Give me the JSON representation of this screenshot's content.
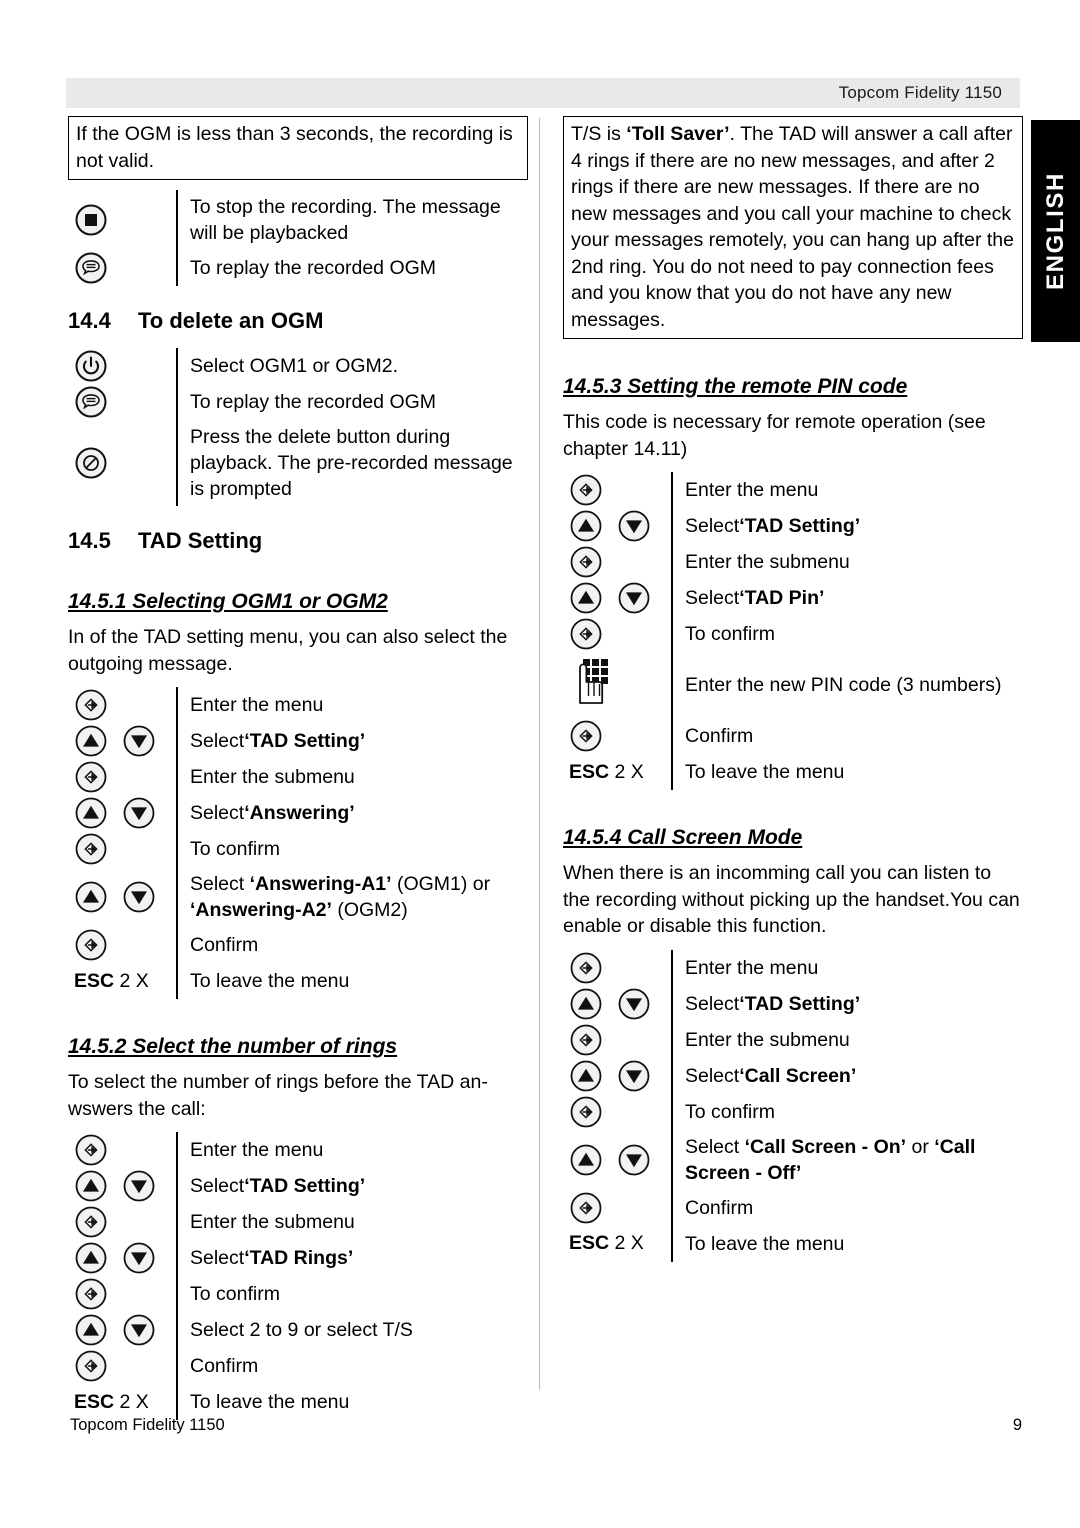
{
  "header": {
    "title": "Topcom Fidelity 1150"
  },
  "lang_tab": {
    "label": "ENGLISH"
  },
  "footer": {
    "doc_name": "Topcom Fidelity 1150",
    "page_number": "9"
  },
  "left_column": {
    "note_box": "If the OGM is less than 3 seconds, the recording is not valid.",
    "ogm_record_steps": [
      {
        "icon_a": "stop-icon",
        "icon_b": "",
        "text": "To stop the recording. The message will be playbacked"
      },
      {
        "icon_a": "replay-ogm-icon",
        "icon_b": "",
        "text": "To replay the recorded OGM"
      }
    ],
    "section_14_4": {
      "number": "14.4",
      "title": "To delete an OGM",
      "steps": [
        {
          "icon_a": "power-icon",
          "icon_b": "",
          "text": "Select OGM1 or OGM2."
        },
        {
          "icon_a": "replay-ogm-icon",
          "icon_b": "",
          "text": "To replay the recorded OGM"
        },
        {
          "icon_a": "delete-icon",
          "icon_b": "",
          "text": "Press the delete button during playback. The pre-recorded message is prompted"
        }
      ]
    },
    "section_14_5": {
      "number": "14.5",
      "title": "TAD Setting"
    },
    "section_14_5_1": {
      "title": "14.5.1 Selecting OGM1 or OGM2",
      "intro": "In of the TAD setting menu, you can also select the outgoing message.",
      "steps": [
        {
          "icon_a": "menu-enter-icon",
          "icon_b": "",
          "text": "Enter the menu"
        },
        {
          "icon_a": "up-arrow-icon",
          "icon_b": "down-arrow-icon",
          "text": "Select ",
          "bold": "‘TAD Setting’",
          "text_after": ""
        },
        {
          "icon_a": "menu-enter-icon",
          "icon_b": "",
          "text": "Enter the submenu"
        },
        {
          "icon_a": "up-arrow-icon",
          "icon_b": "down-arrow-icon",
          "text": "Select ",
          "bold": "‘Answering’",
          "text_after": ""
        },
        {
          "icon_a": "menu-enter-icon",
          "icon_b": "",
          "text": "To confirm"
        },
        {
          "icon_a": "up-arrow-icon",
          "icon_b": "down-arrow-icon",
          "text": "Select ",
          "bold": "‘Answering-A1’",
          "text_after": " (OGM1) or ",
          "bold2": "‘Answering-A2’",
          "text_after2": " (OGM2)"
        },
        {
          "icon_a": "menu-enter-icon",
          "icon_b": "",
          "text": "Confirm"
        },
        {
          "icon_a": "esc-label",
          "esc_bold": "ESC",
          "esc_rest": "2 X",
          "icon_b": "",
          "text": "To leave the menu"
        }
      ]
    },
    "section_14_5_2": {
      "title": "14.5.2 Select the number of rings",
      "intro": "To select the number of rings before the TAD an-wswers the call:",
      "steps": [
        {
          "icon_a": "menu-enter-icon",
          "icon_b": "",
          "text": "Enter the menu"
        },
        {
          "icon_a": "up-arrow-icon",
          "icon_b": "down-arrow-icon",
          "text": "Select ",
          "bold": "‘TAD Setting’"
        },
        {
          "icon_a": "menu-enter-icon",
          "icon_b": "",
          "text": "Enter the submenu"
        },
        {
          "icon_a": "up-arrow-icon",
          "icon_b": "down-arrow-icon",
          "text": "Select ",
          "bold": "‘TAD Rings’"
        },
        {
          "icon_a": "menu-enter-icon",
          "icon_b": "",
          "text": "To confirm"
        },
        {
          "icon_a": "up-arrow-icon",
          "icon_b": "down-arrow-icon",
          "text": "Select 2 to 9 or select T/S"
        },
        {
          "icon_a": "menu-enter-icon",
          "icon_b": "",
          "text": "Confirm"
        },
        {
          "icon_a": "esc-label",
          "esc_bold": "ESC",
          "esc_rest": "2 X",
          "icon_b": "",
          "text": "To leave the menu"
        }
      ]
    }
  },
  "right_column": {
    "note_box_prefix": "T/S is ",
    "note_box_bold": "‘Toll Saver’",
    "note_box_rest": ".  The TAD will answer a call after 4 rings if there are no new messages, and after 2 rings if there are new messages. If there are no new messages and you call your machine to check your messages remotely, you can hang up after the 2nd ring. You do not need to pay connection fees and you know that you do not have any new messages.",
    "section_14_5_3": {
      "title": "14.5.3 Setting the remote PIN code",
      "intro": "This code is necessary for remote operation (see chapter 14.11)",
      "steps": [
        {
          "icon_a": "menu-enter-icon",
          "icon_b": "",
          "text": "Enter the menu"
        },
        {
          "icon_a": "up-arrow-icon",
          "icon_b": "down-arrow-icon",
          "text": "Select ",
          "bold": "‘TAD Setting’"
        },
        {
          "icon_a": "menu-enter-icon",
          "icon_b": "",
          "text": "Enter the submenu"
        },
        {
          "icon_a": "up-arrow-icon",
          "icon_b": "down-arrow-icon",
          "text": "Select ",
          "bold": "‘TAD Pin’"
        },
        {
          "icon_a": "menu-enter-icon",
          "icon_b": "",
          "text": "To confirm"
        },
        {
          "icon_a": "keypad-icon",
          "icon_b": "",
          "text": "Enter the new PIN code (3 numbers)"
        },
        {
          "icon_a": "menu-enter-icon",
          "icon_b": "",
          "text": "Confirm"
        },
        {
          "icon_a": "esc-label",
          "esc_bold": "ESC",
          "esc_rest": "2 X",
          "icon_b": "",
          "text": "To leave the menu"
        }
      ]
    },
    "section_14_5_4": {
      "title": "14.5.4 Call Screen Mode",
      "intro": "When there is an incomming call you can listen to the recording without picking up the handset.You can enable or disable this function.",
      "steps": [
        {
          "icon_a": "menu-enter-icon",
          "icon_b": "",
          "text": "Enter the menu"
        },
        {
          "icon_a": "up-arrow-icon",
          "icon_b": "down-arrow-icon",
          "text": "Select ",
          "bold": "‘TAD Setting’"
        },
        {
          "icon_a": "menu-enter-icon",
          "icon_b": "",
          "text": "Enter the submenu"
        },
        {
          "icon_a": "up-arrow-icon",
          "icon_b": "down-arrow-icon",
          "text": "Select ",
          "bold": "‘Call Screen’"
        },
        {
          "icon_a": "menu-enter-icon",
          "icon_b": "",
          "text": "To confirm"
        },
        {
          "icon_a": "up-arrow-icon",
          "icon_b": "down-arrow-icon",
          "text": "Select ",
          "bold": "‘Call Screen - On’",
          "text_after": " or ",
          "bold2": "‘Call Screen - Off’"
        },
        {
          "icon_a": "menu-enter-icon",
          "icon_b": "",
          "text": "Confirm"
        },
        {
          "icon_a": "esc-label",
          "esc_bold": "ESC",
          "esc_rest": "2 X",
          "icon_b": "",
          "text": "To leave the menu"
        }
      ]
    }
  }
}
